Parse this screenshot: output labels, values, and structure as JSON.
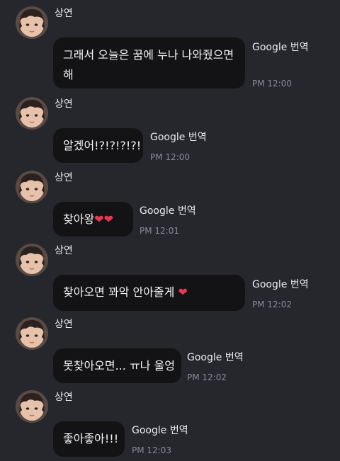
{
  "messages": [
    {
      "sender": "상연",
      "lines": [
        "그래서 오늘은 꿈에 누나 나와줬으면",
        "해"
      ],
      "translate": "Google 번역",
      "time": "PM 12:00"
    },
    {
      "sender": "상연",
      "lines": [
        "알겠어!?!?!?!?!"
      ],
      "translate": "Google 번역",
      "time": "PM 12:00"
    },
    {
      "sender": "상연",
      "lines": [
        "찾아왕"
      ],
      "emoji": "❤❤",
      "translate": "Google 번역",
      "time": "PM 12:01"
    },
    {
      "sender": "상연",
      "lines": [
        "찾아오면 꽈악 안아줄게 "
      ],
      "emoji": "❤",
      "translate": "Google 번역",
      "time": "PM 12:02"
    },
    {
      "sender": "상연",
      "lines": [
        "못찾아오면... ㅠ나 울엉"
      ],
      "translate": "Google 번역",
      "time": "PM 12:02"
    },
    {
      "sender": "상연",
      "lines": [
        "좋아좋아!!!"
      ],
      "translate": "Google 번역",
      "time": "PM 12:03"
    }
  ],
  "colors": {
    "background": "#26272d",
    "bubble": "#131316",
    "heart": "#e23b4e",
    "time": "#8a8b92"
  },
  "icons": {
    "heart": "heart-icon",
    "avatar": "avatar"
  }
}
